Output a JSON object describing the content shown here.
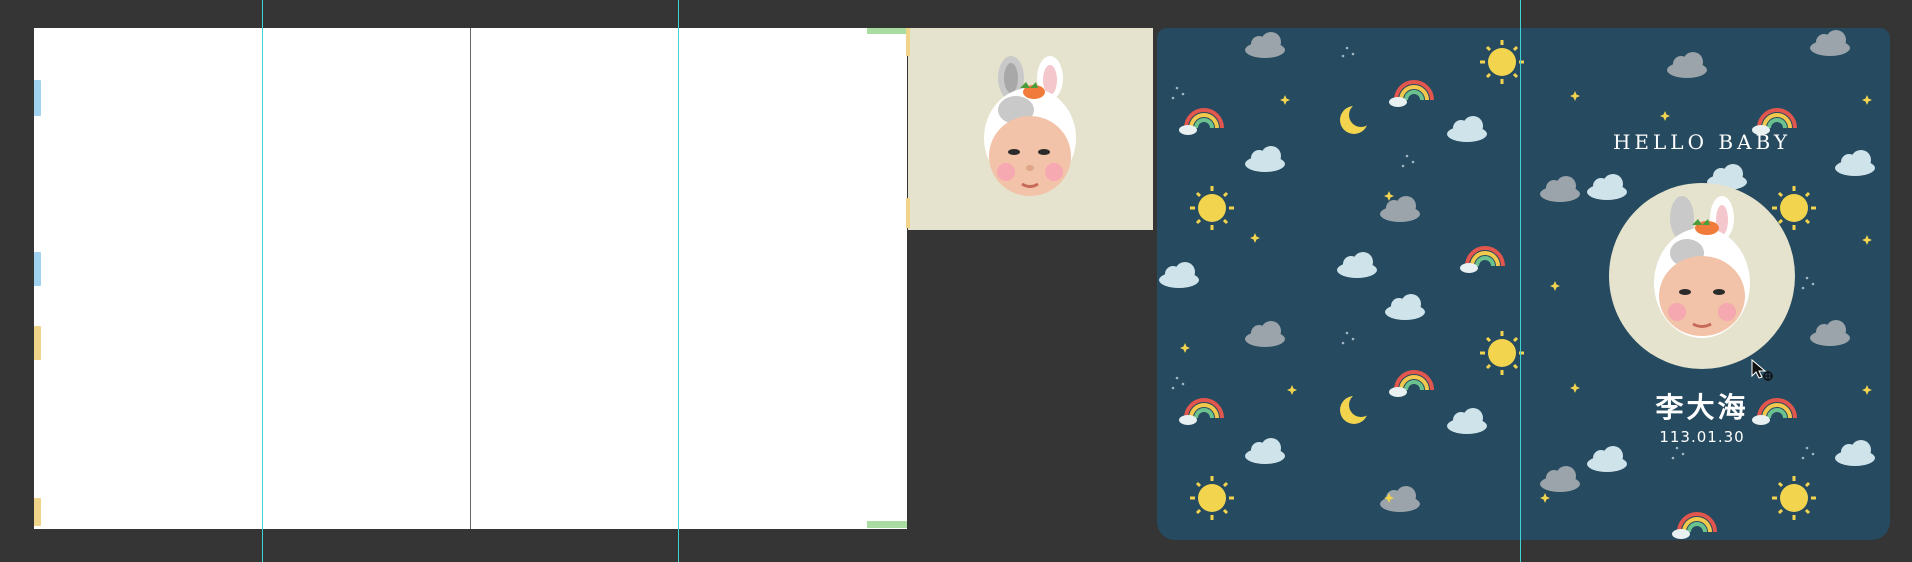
{
  "canvas": {
    "background_color": "#353535",
    "guide_color": "#3fd4d4"
  },
  "spread": {
    "left_page_color": "#ffffff"
  },
  "photo_frame": {
    "background_color": "#e5e2cd",
    "subject": "baby face wearing white bunny hat with carrot"
  },
  "cover": {
    "background_color": "#264a5f",
    "title": "HELLO BABY",
    "name": "李大海",
    "date": "113.01.30",
    "pattern": [
      "sun-icon",
      "cloud-icon",
      "rain-cloud-icon",
      "storm-cloud-icon",
      "rainbow-icon",
      "moon-icon",
      "star-icon"
    ]
  },
  "cursor": {
    "icon": "move-cursor-icon"
  }
}
